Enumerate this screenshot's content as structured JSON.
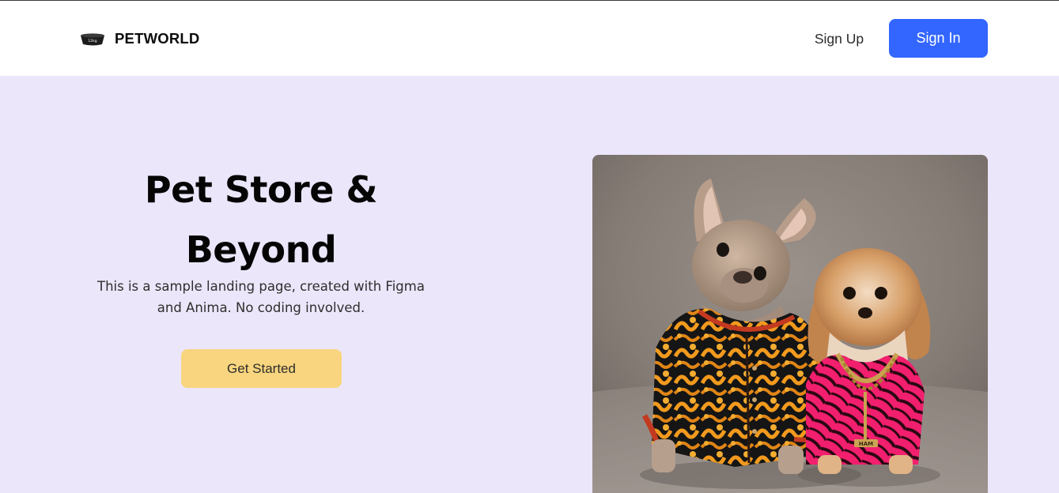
{
  "header": {
    "brand_name": "PETWORLD",
    "brand_icon_text": "12kg",
    "signup_label": "Sign Up",
    "signin_label": "Sign In"
  },
  "hero": {
    "title_line1": "Pet Store &",
    "title_line2": "Beyond",
    "subtitle_line1": "This is a sample landing page, created with Figma",
    "subtitle_line2": "and Anima. No coding involved.",
    "cta_label": "Get Started",
    "photo_tag_text": "HAM"
  },
  "colors": {
    "hero_background": "#ebe6fa",
    "signin_button": "#3366ff",
    "cta_button": "#f8d57e"
  }
}
